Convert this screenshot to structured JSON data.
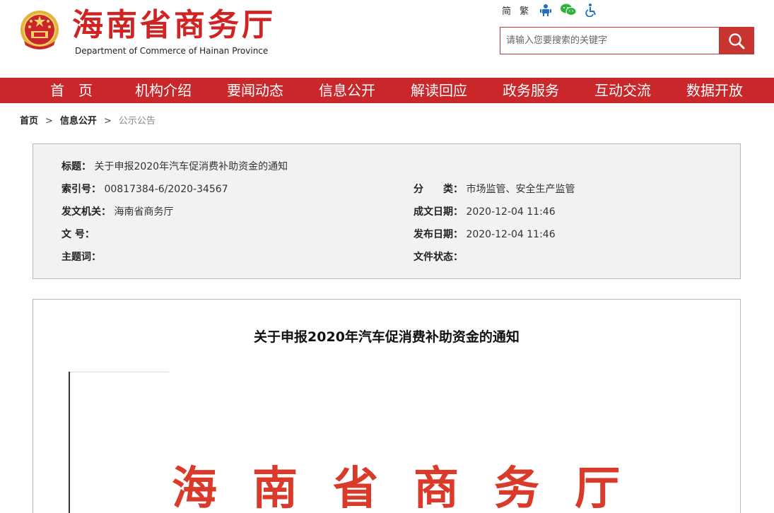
{
  "header": {
    "site_title": "海南省商务厅",
    "site_subtitle": "Department of Commerce of Hainan Province",
    "lang_simplified": "简",
    "lang_traditional": "繁",
    "accessibility_icon": "person-robot-icon",
    "wechat_icon": "wechat-icon",
    "barrier_free_icon": "wheelchair-icon"
  },
  "search": {
    "placeholder": "请输入您要搜索的关键字",
    "value": ""
  },
  "nav": {
    "items": [
      "首　页",
      "机构介绍",
      "要闻动态",
      "信息公开",
      "解读回应",
      "政务服务",
      "互动交流",
      "数据开放"
    ]
  },
  "breadcrumb": {
    "items": [
      "首页",
      "信息公开",
      "公示公告"
    ],
    "separator": ">"
  },
  "meta": {
    "title_label": "标题：",
    "title_value": "关于申报2020年汽车促消费补助资金的通知",
    "index_label": "索引号：",
    "index_value": "00817384-6/2020-34567",
    "category_label": "分　　类：",
    "category_value": "市场监管、安全生产监管",
    "issuer_label": "发文机关：",
    "issuer_value": "海南省商务厅",
    "created_label": "成文日期：",
    "created_value": "2020-12-04 11:46",
    "docno_label": "文 号：",
    "docno_value": "",
    "published_label": "发布日期：",
    "published_value": "2020-12-04 11:46",
    "keywords_label": "主题词：",
    "keywords_value": "",
    "status_label": "文件状态：",
    "status_value": ""
  },
  "article": {
    "title": "关于申报2020年汽车促消费补助资金的通知",
    "doc_header_text": "海南省商务厅"
  },
  "colors": {
    "brand_red": "#c9272a",
    "title_red": "#d02424",
    "doc_red": "#d93a2a"
  }
}
